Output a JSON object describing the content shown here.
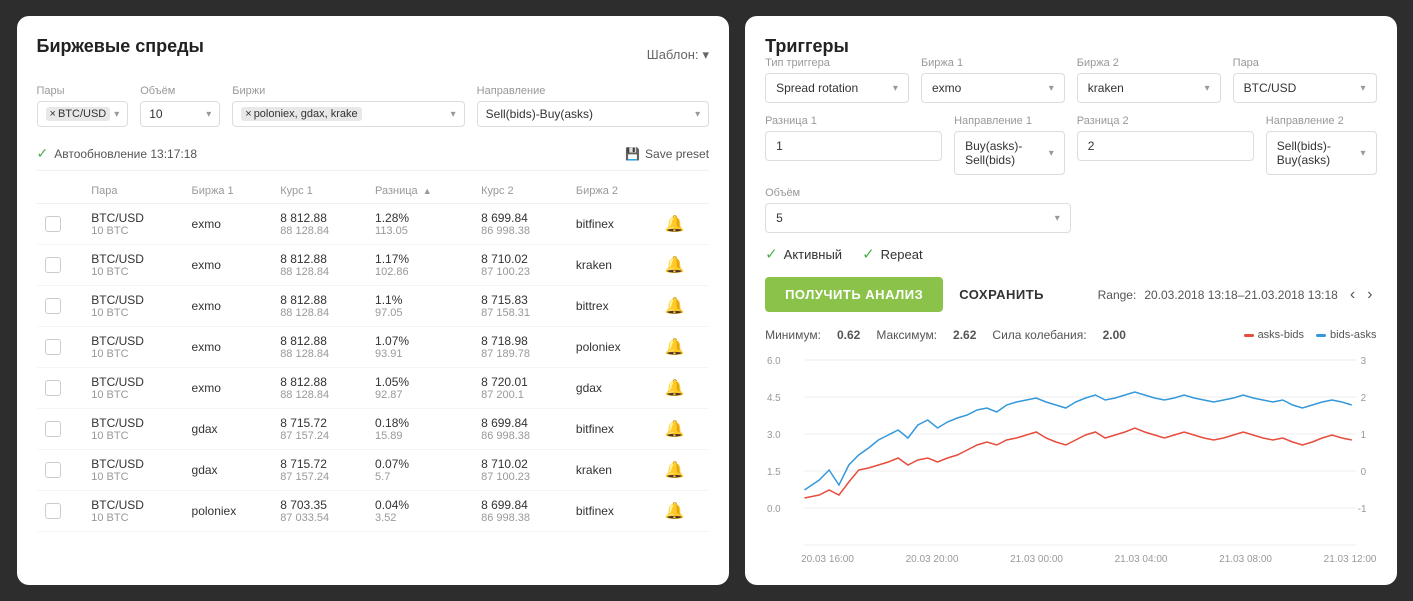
{
  "left_panel": {
    "title": "Биржевые спреды",
    "shablon_label": "Шаблон:",
    "filters": {
      "pairs_label": "Пары",
      "pairs_value": "BTC/USD",
      "volume_label": "Объём",
      "volume_value": "10",
      "exchanges_label": "Биржи",
      "exchanges_value": "poloniex, gdax, krake",
      "direction_label": "Направление",
      "direction_value": "Sell(bids)-Buy(asks)"
    },
    "autoupdate": "Автообновление 13:17:18",
    "save_preset": "Save preset",
    "table_headers": [
      "",
      "Пара",
      "Биржа 1",
      "Курс 1",
      "Разница",
      "Курс 2",
      "Биржа 2",
      ""
    ],
    "table_rows": [
      {
        "pair": "BTC/USD",
        "pair_sub": "10 BTC",
        "exchange1": "exmo",
        "price1": "8 812.88",
        "price1_sub": "88 128.84",
        "diff_pct": "1.28%",
        "diff_val": "113.05",
        "price2": "8 699.84",
        "price2_sub": "86 998.38",
        "exchange2": "bitfinex"
      },
      {
        "pair": "BTC/USD",
        "pair_sub": "10 BTC",
        "exchange1": "exmo",
        "price1": "8 812.88",
        "price1_sub": "88 128.84",
        "diff_pct": "1.17%",
        "diff_val": "102.86",
        "price2": "8 710.02",
        "price2_sub": "87 100.23",
        "exchange2": "kraken"
      },
      {
        "pair": "BTC/USD",
        "pair_sub": "10 BTC",
        "exchange1": "exmo",
        "price1": "8 812.88",
        "price1_sub": "88 128.84",
        "diff_pct": "1.1%",
        "diff_val": "97.05",
        "price2": "8 715.83",
        "price2_sub": "87 158.31",
        "exchange2": "bittrex"
      },
      {
        "pair": "BTC/USD",
        "pair_sub": "10 BTC",
        "exchange1": "exmo",
        "price1": "8 812.88",
        "price1_sub": "88 128.84",
        "diff_pct": "1.07%",
        "diff_val": "93.91",
        "price2": "8 718.98",
        "price2_sub": "87 189.78",
        "exchange2": "poloniex"
      },
      {
        "pair": "BTC/USD",
        "pair_sub": "10 BTC",
        "exchange1": "exmo",
        "price1": "8 812.88",
        "price1_sub": "88 128.84",
        "diff_pct": "1.05%",
        "diff_val": "92.87",
        "price2": "8 720.01",
        "price2_sub": "87 200.1",
        "exchange2": "gdax"
      },
      {
        "pair": "BTC/USD",
        "pair_sub": "10 BTC",
        "exchange1": "gdax",
        "price1": "8 715.72",
        "price1_sub": "87 157.24",
        "diff_pct": "0.18%",
        "diff_val": "15.89",
        "price2": "8 699.84",
        "price2_sub": "86 998.38",
        "exchange2": "bitfinex"
      },
      {
        "pair": "BTC/USD",
        "pair_sub": "10 BTC",
        "exchange1": "gdax",
        "price1": "8 715.72",
        "price1_sub": "87 157.24",
        "diff_pct": "0.07%",
        "diff_val": "5.7",
        "price2": "8 710.02",
        "price2_sub": "87 100.23",
        "exchange2": "kraken"
      },
      {
        "pair": "BTC/USD",
        "pair_sub": "10 BTC",
        "exchange1": "poloniex",
        "price1": "8 703.35",
        "price1_sub": "87 033.54",
        "diff_pct": "0.04%",
        "diff_val": "3.52",
        "price2": "8 699.84",
        "price2_sub": "86 998.38",
        "exchange2": "bitfinex"
      }
    ]
  },
  "right_panel": {
    "title": "Триггеры",
    "trigger_type_label": "Тип триггера",
    "trigger_type_value": "Spread rotation",
    "exchange1_label": "Биржа 1",
    "exchange1_value": "exmo",
    "exchange2_label": "Биржа 2",
    "exchange2_value": "kraken",
    "pair_label": "Пара",
    "pair_value": "BTC/USD",
    "diff1_label": "Разница 1",
    "diff1_value": "1",
    "direction1_label": "Направление 1",
    "direction1_value": "Buy(asks)-Sell(bids)",
    "diff2_label": "Разница 2",
    "diff2_value": "2",
    "direction2_label": "Направление 2",
    "direction2_value": "Sell(bids)-Buy(asks)",
    "volume_label": "Объём",
    "volume_value": "5",
    "active_label": "Активный",
    "repeat_label": "Repeat",
    "btn_analyze": "ПОЛУЧИТЬ АНАЛИЗ",
    "btn_save": "СОХРАНИТЬ",
    "range_label": "Range:",
    "range_value": "20.03.2018 13:18–21.03.2018 13:18",
    "chart_stats": {
      "min_label": "Минимум:",
      "min_val": "0.62",
      "max_label": "Максимум:",
      "max_val": "2.62",
      "swing_label": "Сила колебания:",
      "swing_val": "2.00"
    },
    "legend": [
      {
        "label": "asks-bids",
        "color": "#e74c3c"
      },
      {
        "label": "bids-asks",
        "color": "#3498db"
      }
    ],
    "x_labels": [
      "20.03 16:00",
      "20.03 20:00",
      "21.03 00:00",
      "21.03 04:00",
      "21.03 08:00",
      "21.03 12:00"
    ],
    "y_labels_left": [
      "6.0",
      "4.5",
      "3.0",
      "1.5",
      "0.0"
    ],
    "y_labels_right": [
      "3",
      "2",
      "1",
      "0",
      "-1"
    ]
  }
}
